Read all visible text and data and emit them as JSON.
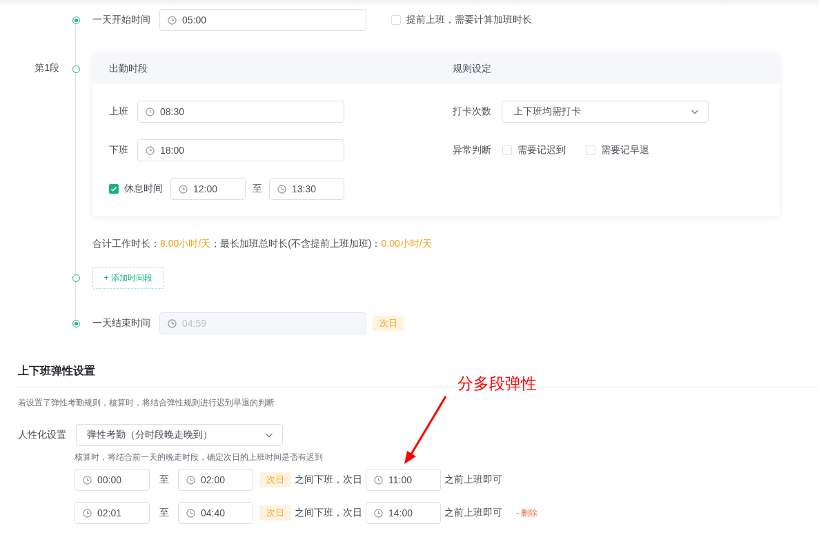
{
  "timeline": {
    "rows": [
      {
        "kind": "start",
        "filled_dot": true,
        "label": "一天开始时间",
        "value": "05:00",
        "option": {
          "label": "提前上班，需要计算加班时长",
          "checked": false
        }
      },
      {
        "kind": "segment",
        "filled_dot": false,
        "label": "第1段",
        "headers": [
          "出勤时段",
          "规则设定"
        ],
        "on_duty": {
          "label": "上班",
          "value": "08:30"
        },
        "off_duty": {
          "label": "下班",
          "value": "18:00"
        },
        "rest": {
          "label": "休息时间",
          "checked": true,
          "from": "12:00",
          "separator": "至",
          "to": "13:30"
        },
        "punch": {
          "label": "打卡次数",
          "value": "上下班均需打卡"
        },
        "exception": {
          "label": "异常判断",
          "options": [
            {
              "label": "需要记迟到",
              "checked": false
            },
            {
              "label": "需要记早退",
              "checked": false
            }
          ]
        }
      },
      {
        "kind": "summary",
        "parts": [
          {
            "text": "合计工作时长：",
            "highlight": false
          },
          {
            "text": "8.00小时/天",
            "highlight": true
          },
          {
            "text": "；最长加班总时长(不含提前上班加班)：",
            "highlight": false
          },
          {
            "text": "0.00小时/天",
            "highlight": true
          }
        ]
      },
      {
        "kind": "add",
        "filled_dot": false,
        "button": "+ 添加时间段"
      },
      {
        "kind": "end",
        "filled_dot": true,
        "label": "一天结束时间",
        "value": "04:59",
        "disabled": true,
        "tag": "次日"
      }
    ]
  },
  "flex": {
    "title": "上下班弹性设置",
    "description": "若设置了弹性考勤规则，核算时，将结合弹性规则进行迟到早退的判断",
    "mode": {
      "label": "人性化设置",
      "value": "弹性考勤（分时段晚走晚到）"
    },
    "hint": "核算时，将结合前一天的晚走时段，确定次日的上班时间是否有迟到",
    "rules": [
      {
        "from": "00:00",
        "separator": "至",
        "to": "02:00",
        "tag": "次日",
        "middle": "之间下班，次日",
        "until": "11:00",
        "suffix": "之前上班即可"
      },
      {
        "from": "02:01",
        "separator": "至",
        "to": "04:40",
        "tag": "次日",
        "middle": "之间下班，次日",
        "until": "14:00",
        "suffix": "之前上班即可",
        "delete": "- 删除"
      }
    ]
  },
  "annotation": {
    "text": "分多段弹性"
  }
}
